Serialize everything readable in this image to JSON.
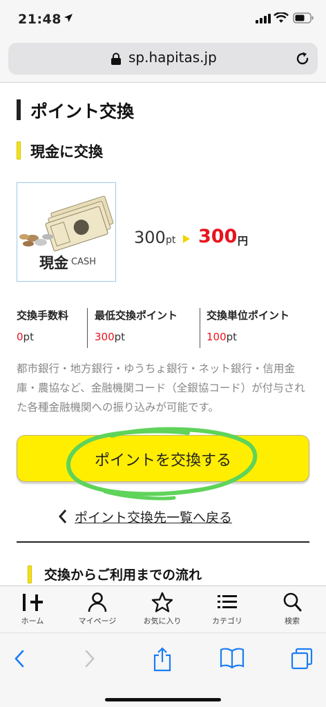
{
  "status": {
    "time": "21:48"
  },
  "browser": {
    "url": "sp.hapitas.jp"
  },
  "page": {
    "title": "ポイント交換",
    "section_title": "現金に交換",
    "cash_label": "現金",
    "cash_label_en": "CASH",
    "rate": {
      "from": "300",
      "from_unit": "pt",
      "to": "300",
      "to_unit": "円"
    },
    "info": [
      {
        "label": "交換手数料",
        "value": "0",
        "unit": "pt"
      },
      {
        "label": "最低交換ポイント",
        "value": "300",
        "unit": "pt"
      },
      {
        "label": "交換単位ポイント",
        "value": "100",
        "unit": "pt"
      }
    ],
    "description": "都市銀行・地方銀行・ゆうちょ銀行・ネット銀行・信用金庫・農協など、金融機関コード（全銀協コード）が付与された各種金融機関への振り込みが可能です。",
    "cta_label": "ポイントを交換する",
    "back_link": "ポイント交換先一覧へ戻る",
    "flow_title": "交換からご利用までの流れ"
  },
  "nav": [
    {
      "label": "ホーム",
      "icon": "hapitas-logo-icon"
    },
    {
      "label": "マイページ",
      "icon": "person-icon"
    },
    {
      "label": "お気に入り",
      "icon": "star-icon"
    },
    {
      "label": "カテゴリ",
      "icon": "list-icon"
    },
    {
      "label": "検索",
      "icon": "search-icon"
    }
  ],
  "colors": {
    "accent_yellow": "#ffee00",
    "red": "#e8141e",
    "highlight_green": "#5fd35a"
  }
}
